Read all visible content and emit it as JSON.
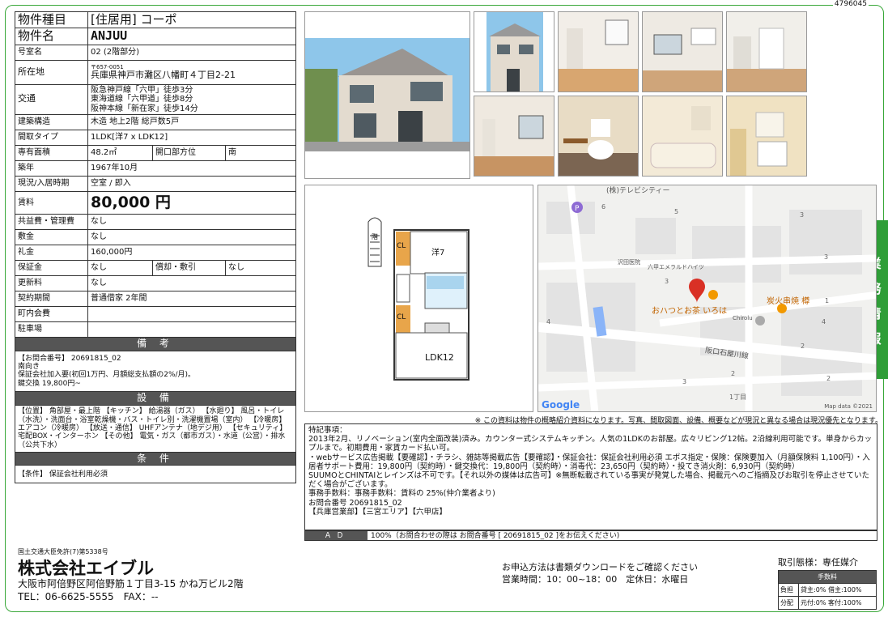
{
  "doc_id": "4796045",
  "side_tab": [
    "業",
    "務",
    "情",
    "報"
  ],
  "spec": {
    "type_label": "物件種目",
    "type_value": "[住居用] コーポ",
    "name_label": "物件名",
    "name_value": "ANJUU",
    "room_label": "号室名",
    "room_value": "02 (2階部分)",
    "location_label": "所在地",
    "postal": "〒657-0051",
    "address": "兵庫県神戸市灘区八幡町４丁目2-21",
    "transit_label": "交通",
    "transit": [
      "阪急神戸線「六甲」徒歩3分",
      "東海道線「六甲道」徒歩8分",
      "阪神本線「新在家」徒歩14分"
    ],
    "structure_label": "建築構造",
    "structure_value": "木造 地上2階 総戸数5戸",
    "layout_label": "間取タイプ",
    "layout_value": "1LDK[洋7 x LDK12]",
    "area_label": "専有面積",
    "area_value": "48.2㎡",
    "opening_label": "開口部方位",
    "opening_value": "南",
    "built_label": "築年",
    "built_value": "1967年10月",
    "status_label": "現況/入居時期",
    "status_value": "空室 / 即入",
    "rent_label": "賃料",
    "rent_value": "80,000 円",
    "fee_label": "共益費・管理費",
    "fee_value": "なし",
    "deposit_label": "敷金",
    "deposit_value": "なし",
    "key_money_label": "礼金",
    "key_money_value": "160,000円",
    "security_label": "保証金",
    "security_value": "なし",
    "amort_label": "償却・敷引",
    "amort_value": "なし",
    "renewal_label": "更新料",
    "renewal_value": "なし",
    "contract_label": "契約期間",
    "contract_value": "普通借家 2年間",
    "community_label": "町内会費",
    "community_value": "",
    "parking_label": "駐車場",
    "parking_value": "",
    "remarks_head": "備 考",
    "remarks": [
      "【お問合番号】 20691815_02",
      "南向き",
      "保証会社加入要(初回1万円、月額総支払額の2%/月)。",
      "鍵交換 19,800円~"
    ],
    "equipment_head": "設 備",
    "equipment": "【位置】 角部屋・最上階 【キッチン】 給湯器（ガス） 【水廻り】 風呂・トイレ（水洗）・洗面台・浴室乾燥機・バス・トイレ別・洗濯機置場（室内） 【冷暖房】 エアコン（冷暖房） 【放送・通信】 UHFアンテナ（地デジ用） 【セキュリティ】 宅配BOX・インターホン 【その他】 電気・ガス（都市ガス）・水道（公営）・排水（公共下水）",
    "conditions_head": "条 件",
    "conditions": "【条件】 保証会社利用必須"
  },
  "floorplan": {
    "room1": "洋7",
    "room2": "LDK12",
    "cl": "CL",
    "stairs": "階"
  },
  "map": {
    "places": [
      "(株)テレビシティー",
      "沢田医院",
      "六甲エメラルドハイツ",
      "おハつとお茶 いろは",
      "炭火串焼 樽",
      "Chirolu",
      "阪口石屋川線"
    ],
    "numbers": [
      "6",
      "5",
      "3",
      "3",
      "3",
      "4",
      "2",
      "1",
      "2",
      "3",
      "2",
      "1丁目",
      "4"
    ],
    "logo": "Google",
    "credit": "Map data ©2021"
  },
  "disclaimer": "※ この資料は物件の概略紹介資料になります。写真、間取図面、設備、概要などが現況と異なる場合は現況優先となります。",
  "notes": {
    "label": "特記事項：",
    "lines": [
      "2013年2月、リノベーション(室内全面改装)済み。カウンター式システムキッチン。人気の1LDKのお部屋。広々リビング12帖。2沿線利用可能です。単身からカップルまで。初期費用・家賃カード払い可。",
      "・webサービス広告掲載【要確認】・チラシ、雑誌等掲載広告【要確認】・保証会社：保証会社利用必須 エポス指定・保険：保険要加入（月額保険料 1,100円）・入居者サポート費用：19,800円（契約時）・鍵交換代：19,800円（契約時）・消毒代：23,650円（契約時）・投てき消火剤：6,930円（契約時）",
      "SUUMOとCHINTAIとレインズは不可です。【それ以外の媒体は広告可】※無断転載されている事実が発覚した場合、掲載元へのご指摘及びお取引を停止させていただく場合がございます。",
      "事務手数料：事務手数料：賃料の 25%(仲介業者より)",
      "お問合番号 20691815_02",
      "【兵庫営業部】【三宮エリア】【六甲店】"
    ]
  },
  "ad": {
    "label": "ＡＤ",
    "text": "100%（お問合わせの際は お問合番号 [ 20691815_02 ]をお伝えください)"
  },
  "footer": {
    "license": "国土交通大臣免許(7)第5338号",
    "company": "株式会社エイブル",
    "address": "大阪市阿倍野区阿倍野筋１丁目3-15 かね万ビル2階",
    "tel": "TEL：06-6625-5555　FAX：--",
    "apply": "お申込方法は書類ダウンロードをご確認ください",
    "hours": "営業時間：10：00~18：00　定休日：水曜日",
    "broker": "取引態様：専任媒介",
    "fee_head": "手数料",
    "burden_label": "負担",
    "burden_value": "貸主:0% 借主:100%",
    "share_label": "分配",
    "share_value": "元付:0% 客付:100%"
  },
  "colors": {
    "accent": "#2f9e38",
    "header": "#555555",
    "pin": "#d93025",
    "food": "#f29900"
  }
}
